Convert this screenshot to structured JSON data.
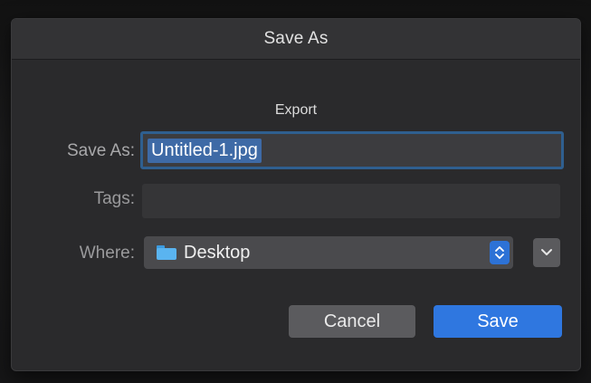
{
  "dialog": {
    "title": "Save As",
    "subtitle": "Export",
    "save_as": {
      "label": "Save As:",
      "value": "Untitled-1.jpg"
    },
    "tags": {
      "label": "Tags:",
      "value": ""
    },
    "where": {
      "label": "Where:",
      "value": "Desktop",
      "icon": "folder-icon"
    },
    "buttons": {
      "cancel": "Cancel",
      "save": "Save"
    }
  },
  "colors": {
    "accent": "#2f77e0",
    "selection": "#3e6aa6",
    "dialog_bg": "#2a2a2c"
  }
}
